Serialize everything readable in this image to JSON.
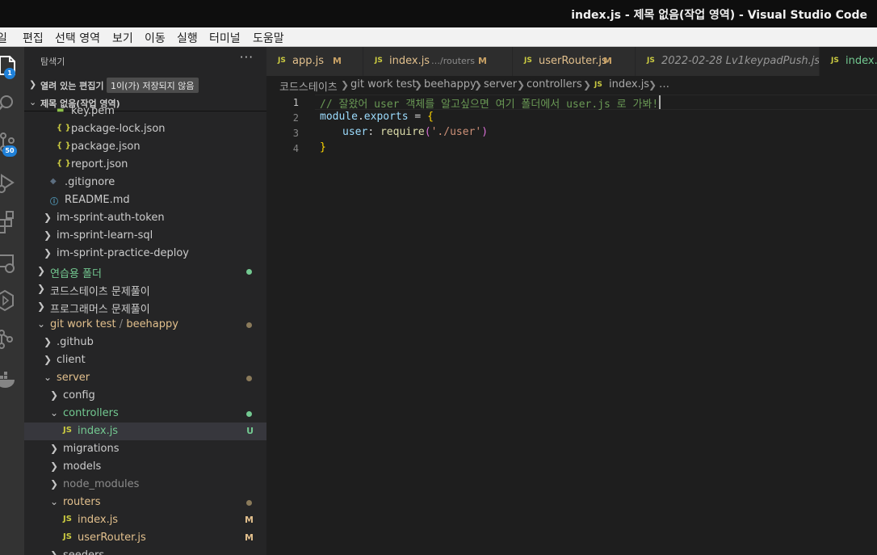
{
  "window": {
    "title": "index.js - 제목 없음(작업 영역) - Visual Studio Code"
  },
  "menu": [
    "일",
    "편집",
    "선택 영역",
    "보기",
    "이동",
    "실행",
    "터미널",
    "도움말"
  ],
  "activity": {
    "explorer_badge": "1",
    "scm_badge": "50"
  },
  "sidebar": {
    "title": "탐색기",
    "more": "···",
    "open_editors": {
      "label": "열려 있는 편집기",
      "unsaved_badge": "1이(가) 저장되지 않음"
    },
    "workspace": {
      "label": "제목 없음(작업 영역)"
    },
    "tree": [
      {
        "name": "key.pem",
        "type": "file",
        "icon": "pem"
      },
      {
        "name": "package-lock.json",
        "type": "file",
        "icon": "json"
      },
      {
        "name": "package.json",
        "type": "file",
        "icon": "json"
      },
      {
        "name": "report.json",
        "type": "file",
        "icon": "json"
      },
      {
        "name": ".gitignore",
        "type": "file",
        "icon": "git"
      },
      {
        "name": "README.md",
        "type": "file",
        "icon": "info"
      },
      {
        "name": "im-sprint-auth-token",
        "type": "folder",
        "state": "collapsed"
      },
      {
        "name": "im-sprint-learn-sql",
        "type": "folder",
        "state": "collapsed"
      },
      {
        "name": "im-sprint-practice-deploy",
        "type": "folder",
        "state": "collapsed"
      },
      {
        "name": "연습용 폴더",
        "type": "folder",
        "state": "collapsed",
        "status": "untracked"
      },
      {
        "name": "코드스테이츠 문제풀이",
        "type": "folder",
        "state": "collapsed"
      },
      {
        "name": "프로그래머스 문제풀이",
        "type": "folder",
        "state": "collapsed"
      },
      {
        "name": "git work test",
        "suffix": "beehappy",
        "type": "folder",
        "state": "expanded",
        "status": "modified"
      },
      {
        "name": ".github",
        "type": "folder",
        "state": "collapsed"
      },
      {
        "name": "client",
        "type": "folder",
        "state": "collapsed"
      },
      {
        "name": "server",
        "type": "folder",
        "state": "expanded",
        "status": "modified"
      },
      {
        "name": "config",
        "type": "folder",
        "state": "collapsed"
      },
      {
        "name": "controllers",
        "type": "folder",
        "state": "expanded",
        "status": "untracked"
      },
      {
        "name": "index.js",
        "type": "file",
        "icon": "js",
        "badge": "U",
        "selected": true
      },
      {
        "name": "migrations",
        "type": "folder",
        "state": "collapsed"
      },
      {
        "name": "models",
        "type": "folder",
        "state": "collapsed"
      },
      {
        "name": "node_modules",
        "type": "folder",
        "state": "collapsed",
        "status": "ignored"
      },
      {
        "name": "routers",
        "type": "folder",
        "state": "expanded",
        "status": "modified"
      },
      {
        "name": "index.js",
        "type": "file",
        "icon": "js",
        "badge": "M"
      },
      {
        "name": "userRouter.js",
        "type": "file",
        "icon": "js",
        "badge": "M"
      },
      {
        "name": "seeders",
        "type": "folder",
        "state": "collapsed"
      }
    ]
  },
  "tabs": [
    {
      "icon": "JS",
      "name": "app.js",
      "description": "",
      "badge": "M"
    },
    {
      "icon": "JS",
      "name": "index.js",
      "description": "…/routers",
      "badge": "M"
    },
    {
      "icon": "JS",
      "name": "userRouter.js",
      "description": "",
      "badge": "M"
    },
    {
      "icon": "JS",
      "name": "2022-02-28 Lv1keypadPush.js",
      "description": "",
      "badge": ""
    },
    {
      "icon": "JS",
      "name": "index.js",
      "description": "",
      "badge": ""
    }
  ],
  "breadcrumbs": [
    "코드스테이츠",
    "git work test",
    "beehappy",
    "server",
    "controllers",
    "index.js",
    "…"
  ],
  "code": {
    "line_numbers": [
      "1",
      "2",
      "3",
      "4"
    ],
    "line1": {
      "comment": "// 잘왔어 user 객체를 알고싶으면 여기 폴더에서 user.js 로 가봐!"
    },
    "line2": {
      "obj": "module",
      "dot": ".",
      "prop": "exports",
      "op": " = ",
      "brace": "{"
    },
    "line3": {
      "key": "user",
      "colon": ": ",
      "fn": "require",
      "paren_open": "(",
      "str": "'./user'",
      "paren_close": ")"
    },
    "line4": {
      "brace": "}"
    }
  },
  "colors": {
    "comment": "#6a9955",
    "variable": "#9cdcfe",
    "function": "#dcdcaa",
    "string": "#ce9178",
    "brace": "#ffd700",
    "modified": "#e2c08d",
    "untracked": "#73c991",
    "ignored": "#8c8c8c",
    "badge_blue": "#1f80d8"
  }
}
